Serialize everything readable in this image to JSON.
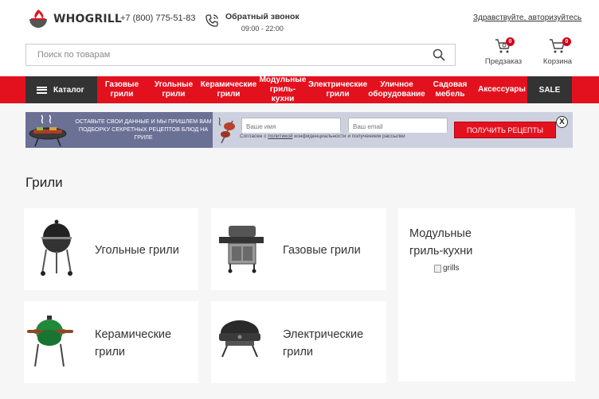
{
  "header": {
    "logo_text": "WHOGRILL",
    "phone": "+7 (800) 775-51-83",
    "callback_title": "Обратный звонок",
    "callback_hours": "09:00 - 22:00",
    "login_link": "Здравствуйте, авторизуйтесь"
  },
  "search": {
    "placeholder": "Поиск по товарам"
  },
  "actions": {
    "preorder_label": "Предзаказ",
    "preorder_count": "0",
    "cart_label": "Корзина",
    "cart_count": "0"
  },
  "nav": {
    "catalog_label": "Каталог",
    "items": [
      {
        "l1": "Газовые",
        "l2": "грили"
      },
      {
        "l1": "Угольные",
        "l2": "грили"
      },
      {
        "l1": "Керамические",
        "l2": "грили"
      },
      {
        "l1": "Модульные",
        "l2": "гриль-кухни"
      },
      {
        "l1": "Электрические",
        "l2": "грили"
      },
      {
        "l1": "Уличное",
        "l2": "оборудование"
      },
      {
        "l1": "Садовая",
        "l2": "мебель"
      },
      {
        "l1": "Аксессуары",
        "l2": ""
      }
    ],
    "sale_label": "SALE"
  },
  "banner": {
    "text": "ОСТАВЬТЕ СВОИ ДАННЫЕ И МЫ ПРИШЛЕМ ВАМ ПОДБОРКУ СЕКРЕТНЫХ РЕЦЕПТОВ БЛЮД НА ГРИЛЕ",
    "name_placeholder": "Ваше имя",
    "email_placeholder": "Ваш email",
    "consent_prefix": "Согласен с ",
    "consent_link": "политикой",
    "consent_suffix": " конфиденциальности и получением рассылки",
    "button_label": "ПОЛУЧИТЬ РЕЦЕПТЫ",
    "close_label": "X"
  },
  "page_title": "Грили",
  "categories": [
    {
      "l1": "Угольные грили",
      "l2": ""
    },
    {
      "l1": "Газовые грили",
      "l2": ""
    },
    {
      "l1": "Модульные",
      "l2": "гриль-кухни",
      "img_alt": "grills"
    },
    {
      "l1": "Керамические",
      "l2": "грили"
    },
    {
      "l1": "Электрические",
      "l2": "грили"
    }
  ],
  "colors": {
    "brand_red": "#e3111e",
    "dark": "#333333",
    "background": "#f6f6f6"
  }
}
